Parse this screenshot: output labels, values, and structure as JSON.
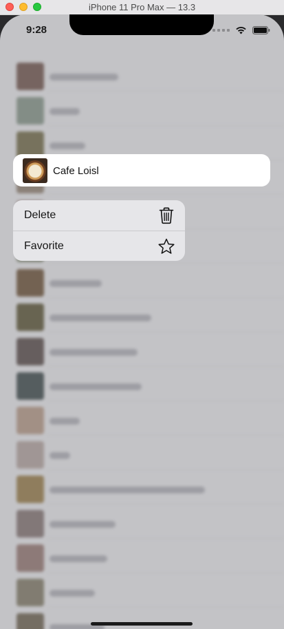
{
  "window": {
    "title": "iPhone 11 Pro Max — 13.3"
  },
  "status_bar": {
    "time": "9:28",
    "icons": [
      "signal-dots-icon",
      "wifi-icon",
      "battery-icon"
    ]
  },
  "preview": {
    "label": "Cafe Loisl",
    "thumbnail": "latte-art-thumbnail"
  },
  "context_menu": {
    "items": [
      {
        "label": "Delete",
        "icon": "trash-icon"
      },
      {
        "label": "Favorite",
        "icon": "star-icon"
      }
    ]
  },
  "colors": {
    "screen_dimmed": "#c3c3c6",
    "menu_background": "#e6e6e9",
    "preview_background": "#ffffff"
  }
}
